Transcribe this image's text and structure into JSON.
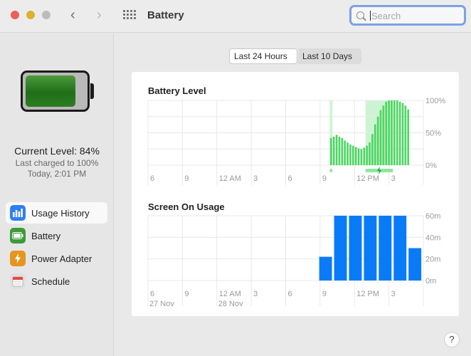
{
  "window": {
    "title": "Battery",
    "traffic_lights": {
      "close": "#ee5f57",
      "minimize": "#deb12d",
      "zoom": "#bcbcbc"
    },
    "nav": {
      "back": "‹",
      "forward": "›"
    }
  },
  "search": {
    "placeholder": "Search",
    "value": ""
  },
  "sidebar": {
    "battery_icon_fill_color": "#2e7f22",
    "current_level": "Current Level: 84%",
    "last_charged": "Last charged to 100%",
    "charged_time": "Today, 2:01 PM",
    "items": [
      {
        "label": "Usage History",
        "icon": "usage-history-icon",
        "color": "#2f7ff2",
        "active": true
      },
      {
        "label": "Battery",
        "icon": "battery-icon",
        "color": "#3c9b38",
        "active": false
      },
      {
        "label": "Power Adapter",
        "icon": "power-adapter-icon",
        "color": "#e5961f",
        "active": false
      },
      {
        "label": "Schedule",
        "icon": "schedule-icon",
        "color": "#e0e0e0",
        "active": false
      }
    ]
  },
  "segments": {
    "active": "Last 24 Hours",
    "inactive": "Last 10 Days"
  },
  "help_label": "?",
  "chart_data": [
    {
      "type": "bar",
      "title": "Battery Level",
      "x_tick_labels": [
        "6",
        "9",
        "12 AM",
        "3",
        "6",
        "9",
        "12 PM",
        "3"
      ],
      "y_tick_labels": [
        "100%",
        "50%",
        "0%"
      ],
      "ylim": [
        0,
        100
      ],
      "bar_color": "#4fd564",
      "charging_shade_color": "#cdf4d2",
      "charging_indicator_color": "#8ee79a",
      "charging_icon": "lightning-icon",
      "grid": true,
      "slots_total": 100,
      "first_bar_slot": 66,
      "charging_slot_ranges": [
        [
          66,
          67
        ],
        [
          79,
          89
        ]
      ],
      "values": [
        42,
        44,
        47,
        44,
        42,
        38,
        35,
        32,
        30,
        28,
        26,
        25,
        27,
        30,
        35,
        48,
        63,
        75,
        85,
        92,
        98,
        100,
        100,
        100,
        100,
        98,
        96,
        92,
        86
      ]
    },
    {
      "type": "bar",
      "title": "Screen On Usage",
      "x_tick_labels": [
        "6",
        "9",
        "12 AM",
        "3",
        "6",
        "9",
        "12 PM",
        "3"
      ],
      "date_labels": [
        "27 Nov",
        "28 Nov"
      ],
      "y_tick_labels": [
        "60m",
        "40m",
        "20m",
        "0m"
      ],
      "ylim": [
        0,
        60
      ],
      "bar_color": "#0a7bf7",
      "grid": true,
      "slots_total": 8,
      "first_bar_slot": 5,
      "values": [
        22,
        60,
        60,
        60,
        60,
        60,
        30
      ]
    }
  ]
}
